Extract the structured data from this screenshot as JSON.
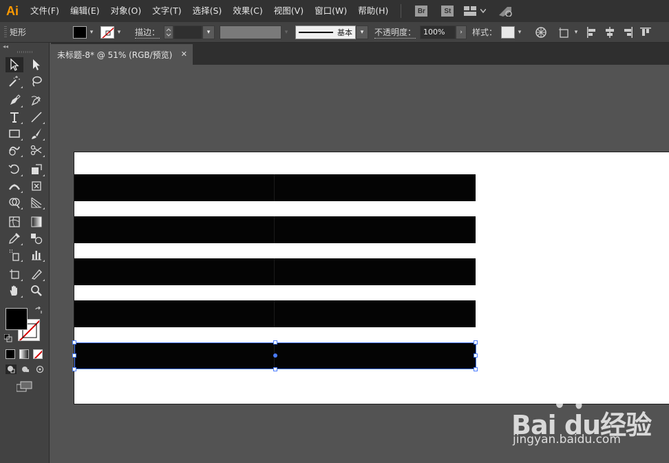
{
  "app": {
    "logo": "Ai",
    "accent": "#ff9a00"
  },
  "menubar": {
    "items": [
      "文件(F)",
      "编辑(E)",
      "对象(O)",
      "文字(T)",
      "选择(S)",
      "效果(C)",
      "视图(V)",
      "窗口(W)",
      "帮助(H)"
    ],
    "bridge_badge": "Br",
    "stock_badge": "St"
  },
  "controlbar": {
    "object_type": "矩形",
    "stroke_label": "描边：",
    "stroke_style": "基本",
    "opacity_label": "不透明度：",
    "opacity_value": "100%",
    "style_label": "样式："
  },
  "tab": {
    "title": "未标题-8* @ 51% (RGB/预览)",
    "close": "✕"
  },
  "toolpanel": {
    "collapse": "◂◂"
  },
  "canvas": {
    "fill_color": "#040404",
    "selection_color": "#4a7cff",
    "bar_count": 5
  },
  "watermark": {
    "brand": "Bai du经验",
    "url": "jingyan.baidu.com"
  }
}
